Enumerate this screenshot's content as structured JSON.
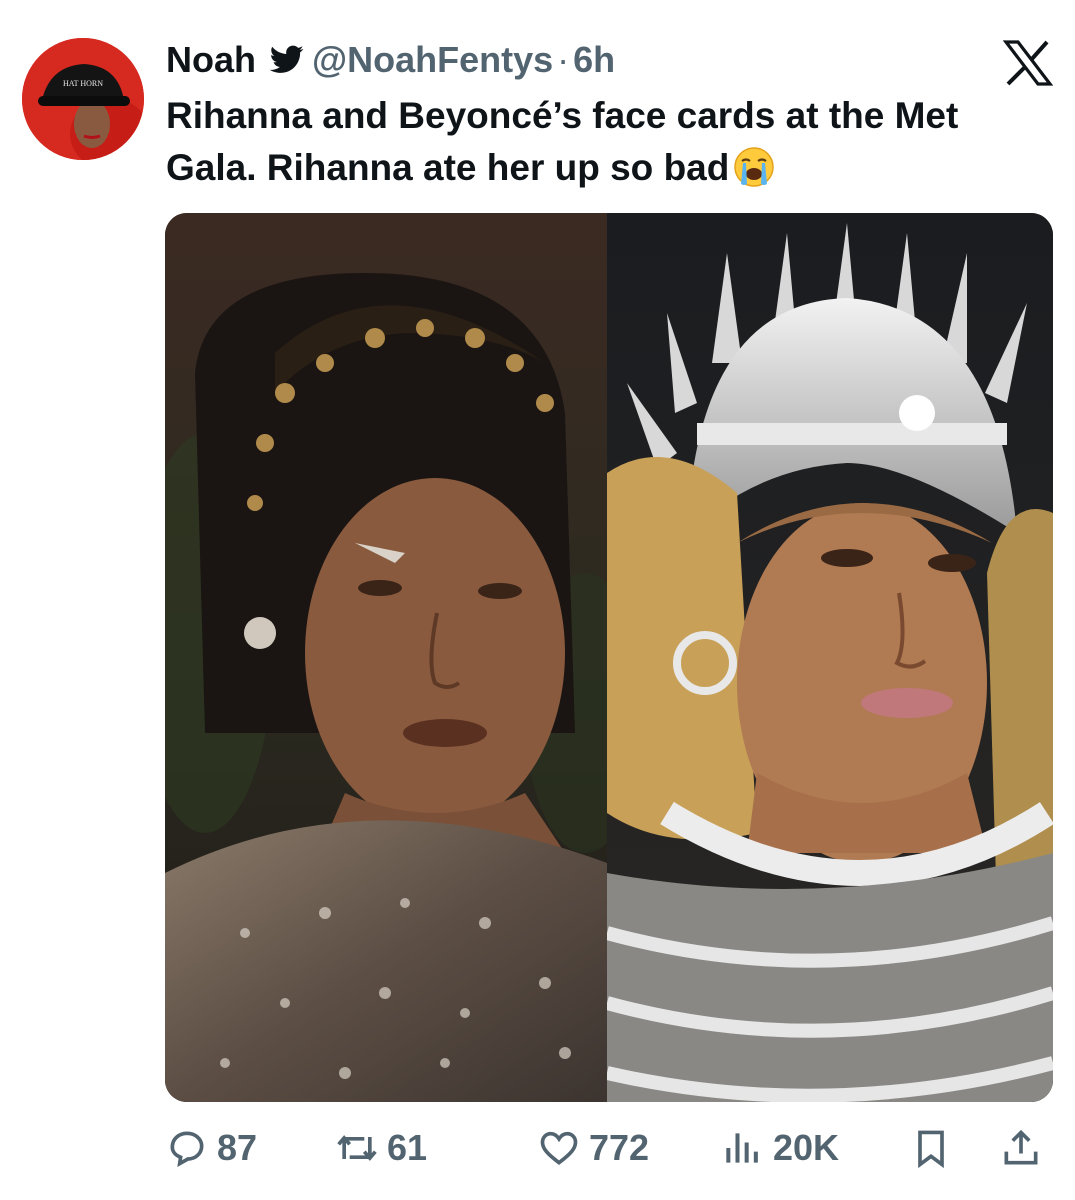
{
  "author": {
    "display_name": "Noah",
    "handle": "@NoahFentys",
    "separator": "·",
    "time": "6h",
    "verified_icon": "verified-badge-icon",
    "avatar_cap_text": "HAT HORN"
  },
  "platform_logo": "x-logo-icon",
  "tweet": {
    "text": "Rihanna and Beyoncé’s face cards at the Met Gala. Rihanna ate her up so bad",
    "emoji": "loudly-crying-face-emoji"
  },
  "media": {
    "left_photo": "rihanna-met-gala-photo",
    "right_photo": "beyonce-met-gala-photo"
  },
  "actions": {
    "replies": "87",
    "retweets": "61",
    "likes": "772",
    "views": "20K",
    "icons": [
      "reply-icon",
      "retweet-icon",
      "like-icon",
      "views-icon",
      "bookmark-icon",
      "share-icon"
    ]
  },
  "colors": {
    "text_primary": "#0f1419",
    "text_secondary": "#536471",
    "background": "#ffffff"
  }
}
